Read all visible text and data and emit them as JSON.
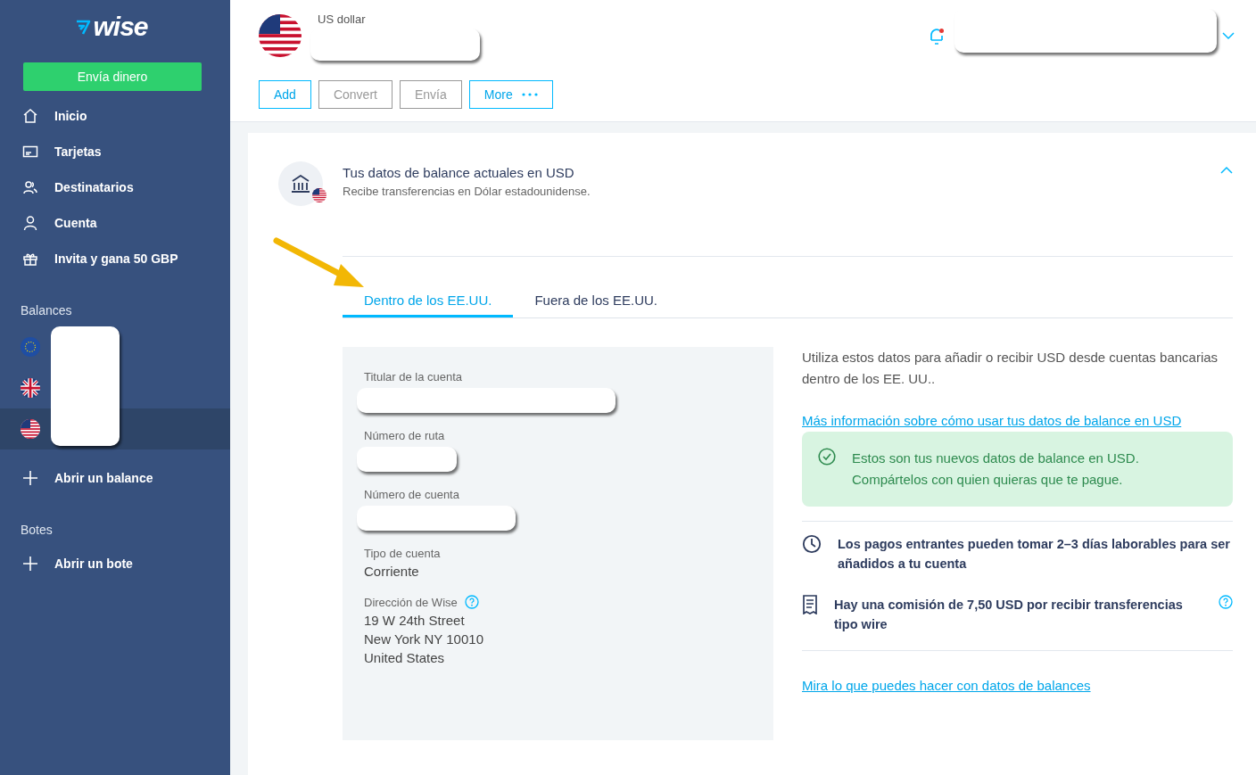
{
  "sidebar": {
    "logo": "wise",
    "send_button": "Envía dinero",
    "nav": [
      {
        "label": "Inicio",
        "kind": "home"
      },
      {
        "label": "Tarjetas",
        "kind": "card"
      },
      {
        "label": "Destinatarios",
        "kind": "people"
      },
      {
        "label": "Cuenta",
        "kind": "person"
      },
      {
        "label": "Invita y gana 50 GBP",
        "kind": "gift"
      }
    ],
    "balances_heading": "Balances",
    "balances": [
      {
        "kind": "eu",
        "selected": false
      },
      {
        "kind": "gb",
        "selected": false
      },
      {
        "kind": "us",
        "selected": true
      }
    ],
    "open_balance": "Abrir un balance",
    "jars_heading": "Botes",
    "open_jar": "Abrir un bote"
  },
  "header": {
    "currency": "US dollar",
    "notification": true,
    "actions": [
      {
        "label": "Add",
        "disabled": false,
        "kind": "plain"
      },
      {
        "label": "Convert",
        "disabled": true,
        "kind": "plain"
      },
      {
        "label": "Envía",
        "disabled": true,
        "kind": "plain"
      },
      {
        "label": "More",
        "disabled": false,
        "kind": "more"
      }
    ]
  },
  "card": {
    "title": "Tus datos de balance actuales en USD",
    "subtitle": "Recibe transferencias en Dólar estadounidense.",
    "expanded": true,
    "tabs": [
      {
        "label": "Dentro de los EE.UU.",
        "selected": true
      },
      {
        "label": "Fuera de los EE.UU.",
        "selected": false
      }
    ],
    "details": [
      {
        "label": "Titular de la cuenta",
        "kind": "redacted"
      },
      {
        "label": "Número de ruta",
        "kind": "redacted"
      },
      {
        "label": "Número de cuenta",
        "kind": "redacted"
      },
      {
        "label": "Tipo de cuenta",
        "kind": "text",
        "lines": [
          "Corriente"
        ]
      },
      {
        "label": "Dirección de Wise",
        "kind": "text",
        "help": true,
        "lines": [
          "19 W 24th Street",
          "New York NY 10010",
          "United States"
        ]
      }
    ],
    "intro": "Utiliza estos datos para añadir o recibir USD desde cuentas bancarias dentro de los EE. UU..",
    "link": "Más información sobre cómo usar tus datos de balance en USD",
    "notice": [
      "Estos son tus nuevos datos de balance en USD.",
      "Compártelos con quien quieras que te pague."
    ],
    "facts": [
      {
        "kind": "clock",
        "text": "Los pagos entrantes pueden tomar 2–3 días laborables para ser añadidos a tu cuenta",
        "help": false
      },
      {
        "kind": "receipt",
        "text": "Hay una comisión de 7,50 USD por recibir transferencias tipo wire",
        "help": true
      }
    ],
    "bottom_link": "Mira lo que puedes hacer con datos de balances"
  }
}
